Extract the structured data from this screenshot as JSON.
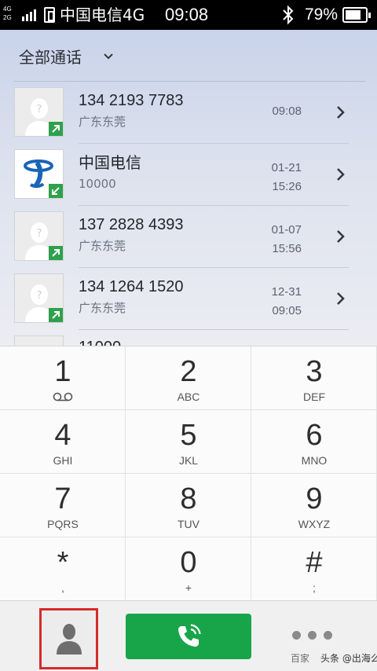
{
  "status_bar": {
    "network_top": "4G",
    "network_bottom": "2G",
    "carrier": "中国电信4G",
    "time": "09:08",
    "battery": "79%"
  },
  "header": {
    "filter_label": "全部通话"
  },
  "call_log": [
    {
      "name": "134 2193 7783",
      "location": "广东东莞",
      "date": "",
      "time": "09:08",
      "avatar": "person-placeholder-icon",
      "call_type": "outgoing"
    },
    {
      "name": "中国电信",
      "location": "10000",
      "date": "01-21",
      "time": "15:26",
      "avatar": "china-telecom-logo",
      "call_type": "incoming"
    },
    {
      "name": "137 2828 4393",
      "location": "广东东莞",
      "date": "01-07",
      "time": "15:56",
      "avatar": "person-placeholder-icon",
      "call_type": "outgoing"
    },
    {
      "name": "134 1264 1520",
      "location": "广东东莞",
      "date": "12-31",
      "time": "09:05",
      "avatar": "person-placeholder-icon",
      "call_type": "outgoing"
    },
    {
      "name": "11000",
      "location": "",
      "date": "",
      "time": "",
      "avatar": "person-placeholder-icon",
      "call_type": "outgoing"
    }
  ],
  "keypad": [
    {
      "digit": "1",
      "letters": ""
    },
    {
      "digit": "2",
      "letters": "ABC"
    },
    {
      "digit": "3",
      "letters": "DEF"
    },
    {
      "digit": "4",
      "letters": "GHI"
    },
    {
      "digit": "5",
      "letters": "JKL"
    },
    {
      "digit": "6",
      "letters": "MNO"
    },
    {
      "digit": "7",
      "letters": "PQRS"
    },
    {
      "digit": "8",
      "letters": "TUV"
    },
    {
      "digit": "9",
      "letters": "WXYZ"
    },
    {
      "digit": "*",
      "letters": ","
    },
    {
      "digit": "0",
      "letters": "+"
    },
    {
      "digit": "#",
      "letters": ";"
    }
  ],
  "bottom_bar": {
    "contacts_icon": "person-icon",
    "call_icon": "phone-icon",
    "more_icon": "more-dots-icon"
  },
  "watermark": {
    "prefix": "百家",
    "text": "头条 @出海么"
  },
  "colors": {
    "call_button": "#18a54a",
    "highlight_box": "#d62b2b",
    "call_badge": "#2fa14c"
  }
}
